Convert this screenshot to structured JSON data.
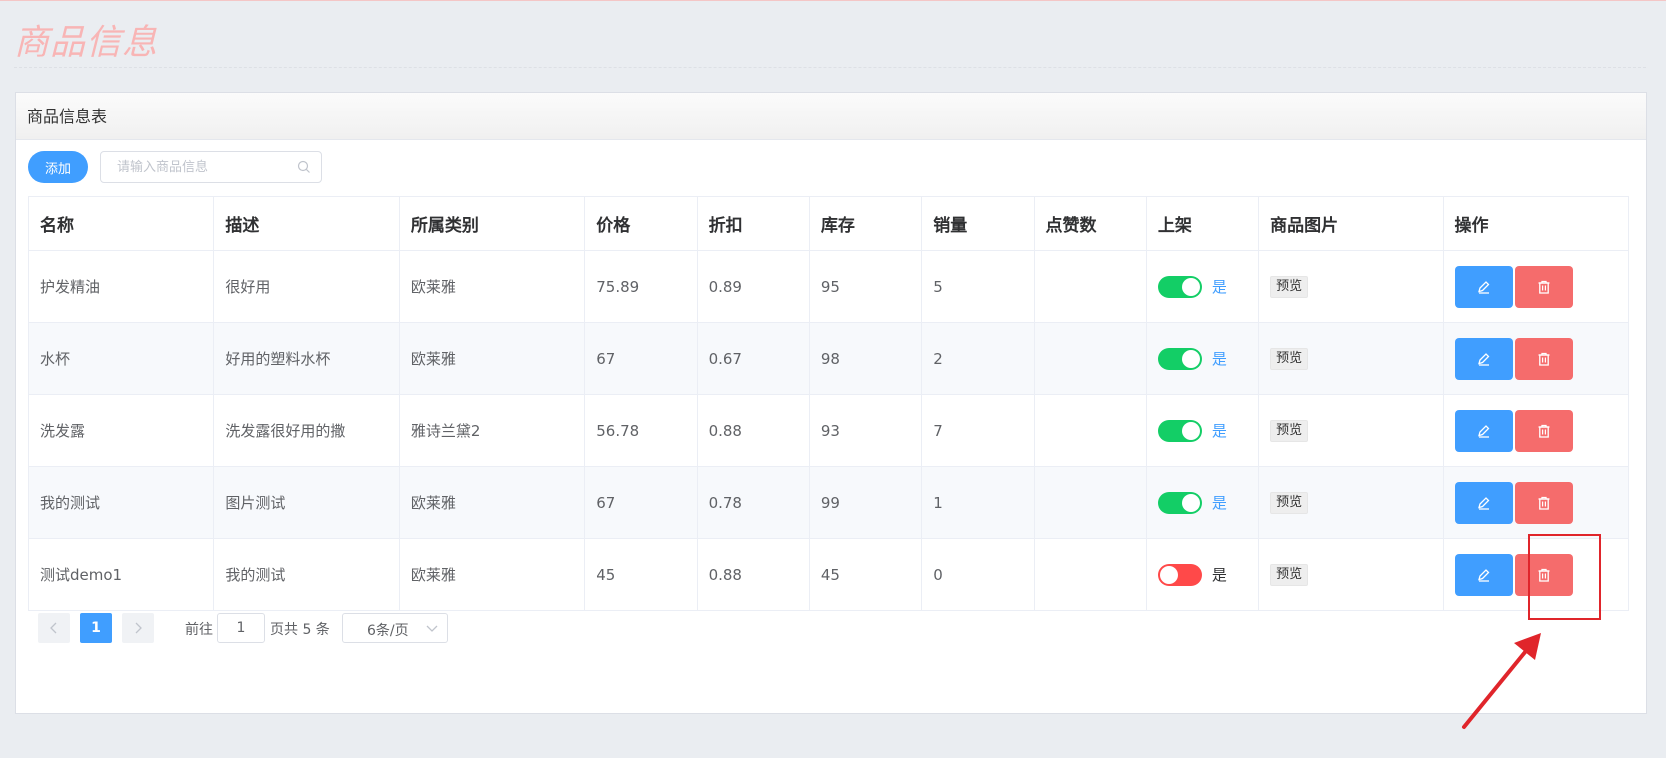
{
  "page": {
    "title": "商品信息"
  },
  "panel": {
    "title": "商品信息表"
  },
  "toolbar": {
    "add_label": "添加",
    "search_placeholder": "请输入商品信息"
  },
  "table": {
    "columns": [
      "名称",
      "描述",
      "所属类别",
      "价格",
      "折扣",
      "库存",
      "销量",
      "点赞数",
      "上架",
      "商品图片",
      "操作"
    ],
    "rows": [
      {
        "name": "护发精油",
        "desc": "很好用",
        "category": "欧莱雅",
        "price": "75.89",
        "discount": "0.89",
        "stock": "95",
        "sales": "5",
        "likes": "",
        "on_sale": true,
        "on_sale_label": "是",
        "preview": "预览"
      },
      {
        "name": "水杯",
        "desc": "好用的塑料水杯",
        "category": "欧莱雅",
        "price": "67",
        "discount": "0.67",
        "stock": "98",
        "sales": "2",
        "likes": "",
        "on_sale": true,
        "on_sale_label": "是",
        "preview": "预览"
      },
      {
        "name": "洗发露",
        "desc": "洗发露很好用的撒",
        "category": "雅诗兰黛2",
        "price": "56.78",
        "discount": "0.88",
        "stock": "93",
        "sales": "7",
        "likes": "",
        "on_sale": true,
        "on_sale_label": "是",
        "preview": "预览"
      },
      {
        "name": "我的测试",
        "desc": "图片测试",
        "category": "欧莱雅",
        "price": "67",
        "discount": "0.78",
        "stock": "99",
        "sales": "1",
        "likes": "",
        "on_sale": true,
        "on_sale_label": "是",
        "preview": "预览"
      },
      {
        "name": "测试demo1",
        "desc": "我的测试",
        "category": "欧莱雅",
        "price": "45",
        "discount": "0.88",
        "stock": "45",
        "sales": "0",
        "likes": "",
        "on_sale": false,
        "on_sale_label": "是",
        "preview": "预览"
      }
    ]
  },
  "pagination": {
    "current_page": "1",
    "goto_label": "前往",
    "goto_value": "1",
    "total_label": "页共 5 条",
    "page_size": "6条/页"
  },
  "colors": {
    "primary": "#409eff",
    "danger": "#f56c6c",
    "switch_on": "#13ce66",
    "switch_off": "#ff4949",
    "annotation": "#e0252b"
  },
  "icons": {
    "edit": "edit-icon",
    "delete": "trash-icon",
    "search": "search-icon"
  }
}
